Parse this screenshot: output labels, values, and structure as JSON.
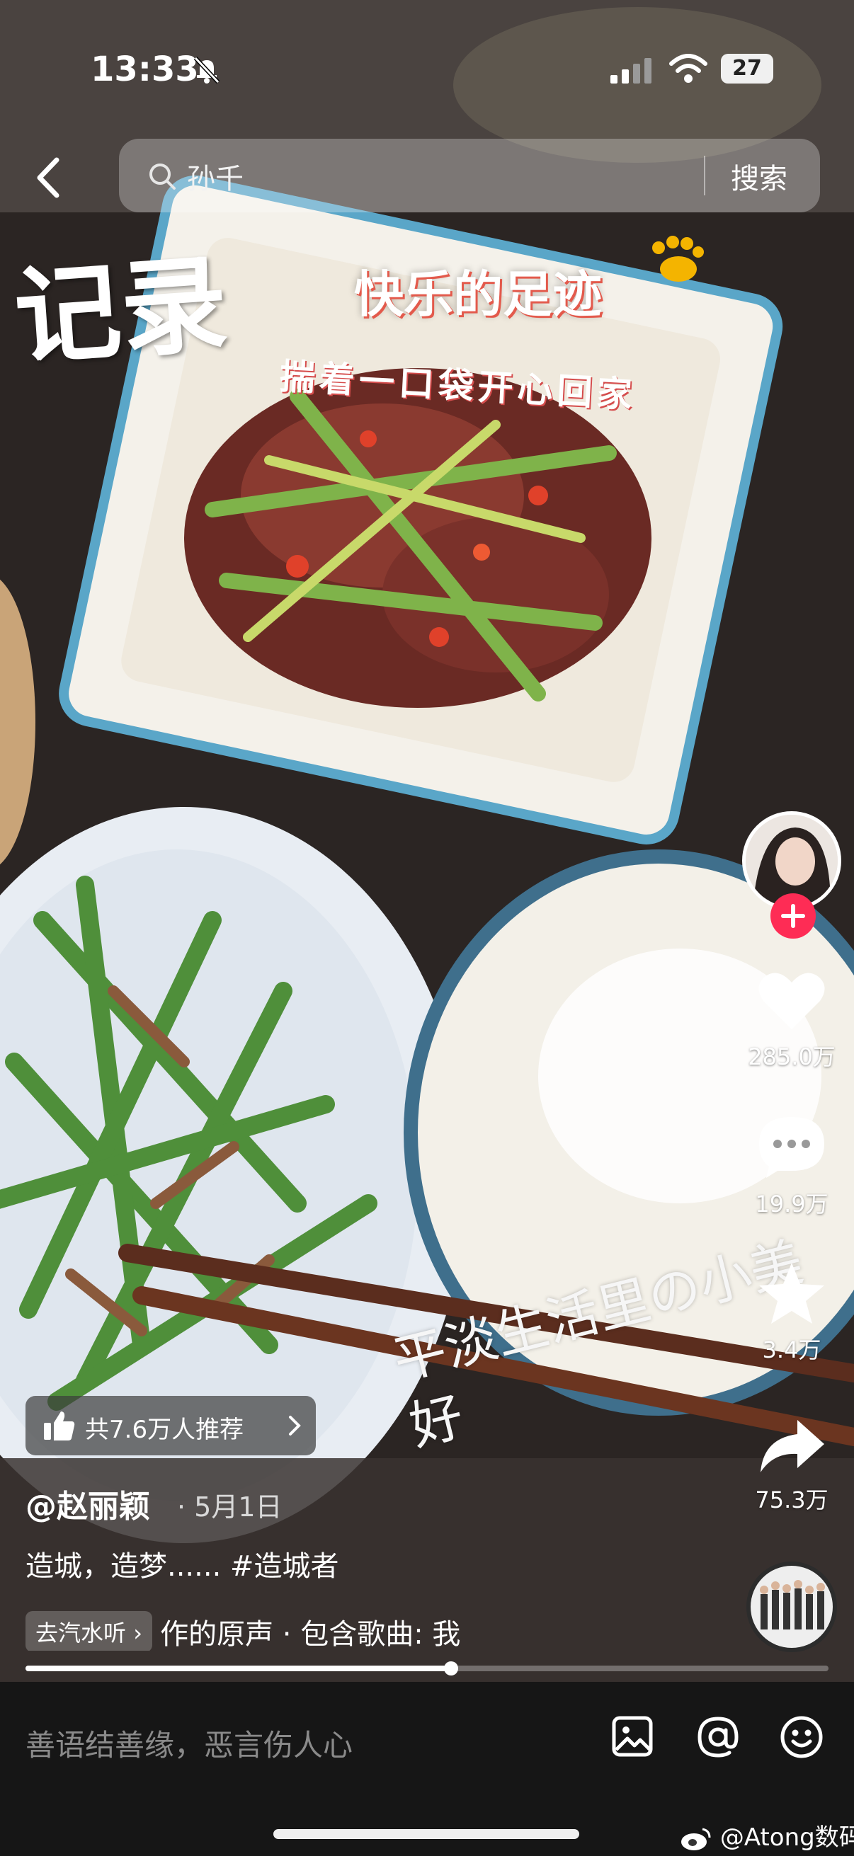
{
  "status_bar": {
    "time": "13:33",
    "battery": "27",
    "icons": [
      "bell-slash-icon",
      "signal-icon",
      "wifi-icon",
      "battery-icon"
    ]
  },
  "search": {
    "query": "孙千",
    "button_label": "搜索"
  },
  "video_overlay": {
    "title": "记录",
    "subtitle": "快乐的足迹",
    "subtitle2": "揣着一口袋开心回家",
    "footer_text": "平淡生活里の小美好"
  },
  "actions": {
    "like_count": "285.0万",
    "comment_count": "19.9万",
    "favorite_count": "3.4万",
    "share_count": "75.3万"
  },
  "recommend": {
    "label": "共7.6万人推荐"
  },
  "post": {
    "author": "@赵丽颖",
    "date": "· 5月1日",
    "caption": "造城，造梦...... #造城者"
  },
  "music": {
    "tag": "去汽水听",
    "text": "作的原声 · 包含歌曲: 我"
  },
  "progress": {
    "fraction": 0.53
  },
  "comment_bar": {
    "placeholder": "善语结善缘，恶言伤人心"
  },
  "watermark": "@Atong数码",
  "colors": {
    "follow_red": "#fe2c55",
    "background": "#141212"
  }
}
